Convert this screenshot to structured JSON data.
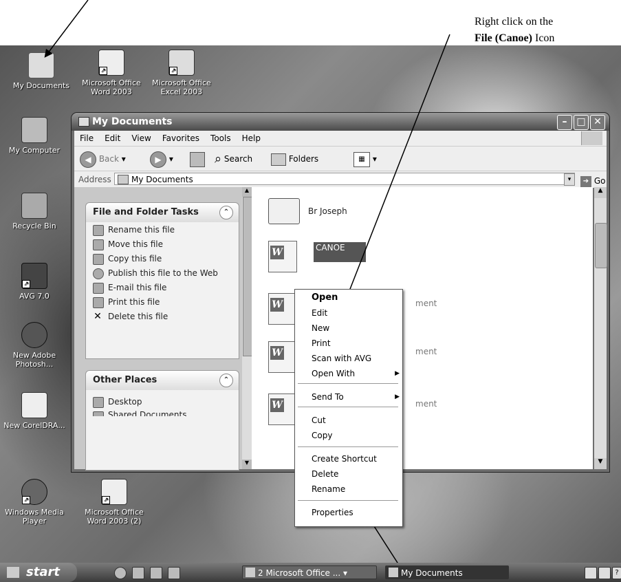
{
  "annotation": {
    "line1": "Right click on the",
    "line2_bold": "File (Canoe)",
    "line2_rest": " Icon"
  },
  "desktop_icons": [
    {
      "label": "My Documents"
    },
    {
      "label": "Microsoft Office Word 2003"
    },
    {
      "label": "Microsoft Office Excel 2003"
    },
    {
      "label": "My Computer"
    },
    {
      "label": "Recycle Bin"
    },
    {
      "label": "AVG 7.0"
    },
    {
      "label": "New Adobe Photosh..."
    },
    {
      "label": "New CorelDRA..."
    },
    {
      "label": "Windows Media Player"
    },
    {
      "label": "Microsoft Office Word 2003 (2)"
    }
  ],
  "window": {
    "title": "My Documents",
    "menu": [
      "File",
      "Edit",
      "View",
      "Favorites",
      "Tools",
      "Help"
    ],
    "toolbar": {
      "back": "Back",
      "search": "Search",
      "folders": "Folders"
    },
    "address_label": "Address",
    "address_value": "My Documents",
    "go": "Go"
  },
  "file_tasks": {
    "title": "File and Folder Tasks",
    "items": [
      "Rename this file",
      "Move this file",
      "Copy this file",
      "Publish this file to the Web",
      "E-mail this file",
      "Print this file",
      "Delete this file"
    ]
  },
  "other_places": {
    "title": "Other Places",
    "items": [
      "Desktop",
      "Shared Documents"
    ]
  },
  "files": [
    {
      "name": "Br Joseph"
    },
    {
      "name": "CANOE"
    },
    {
      "suffix": "ment"
    },
    {
      "suffix": "ment"
    },
    {
      "suffix": "ment"
    }
  ],
  "context_menu": {
    "items": [
      "Open",
      "Edit",
      "New",
      "Print",
      "Scan with AVG",
      "Open With",
      "Send To",
      "Cut",
      "Copy",
      "Create Shortcut",
      "Delete",
      "Rename",
      "Properties"
    ]
  },
  "taskbar": {
    "start": "start",
    "task1": "2 Microsoft Office ...",
    "task2": "My Documents"
  }
}
